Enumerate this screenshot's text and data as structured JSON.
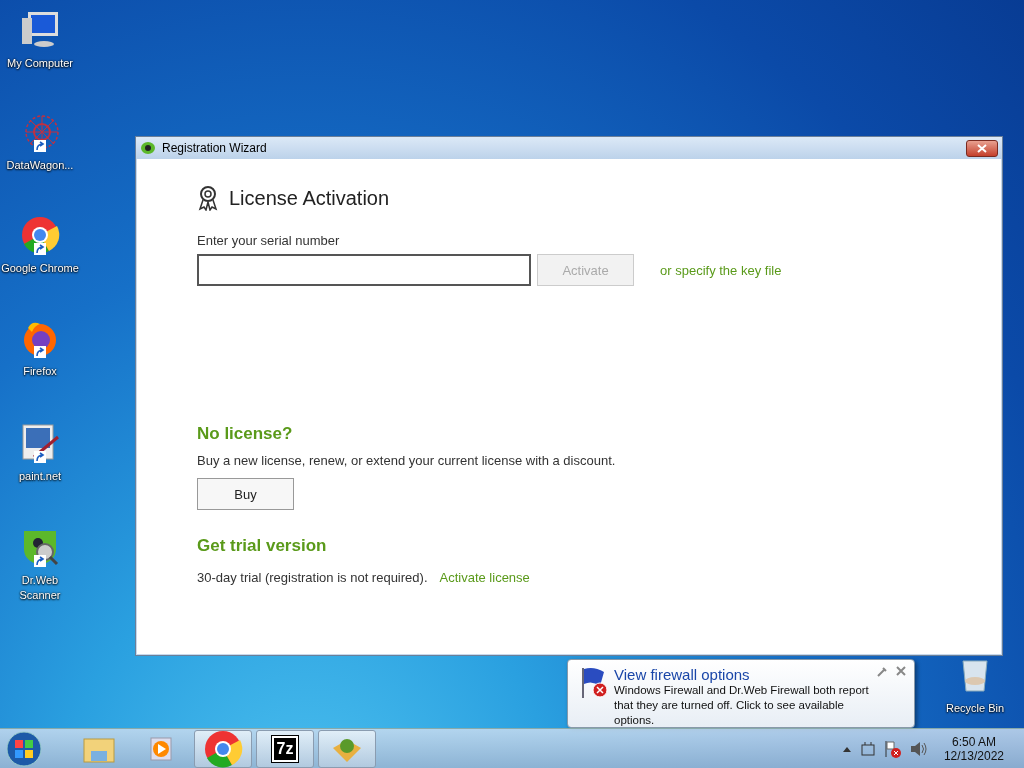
{
  "desktop_icons": [
    {
      "kind": "computer",
      "label": "My Computer",
      "shortcut": false
    },
    {
      "kind": "datawagon",
      "label": "DataWagon...",
      "shortcut": true
    },
    {
      "kind": "chrome",
      "label": "Google Chrome",
      "shortcut": true
    },
    {
      "kind": "firefox",
      "label": "Firefox",
      "shortcut": true
    },
    {
      "kind": "paint",
      "label": "paint.net",
      "shortcut": true
    },
    {
      "kind": "drweb",
      "label": "Dr.Web Scanner",
      "shortcut": true
    },
    {
      "kind": "recycle",
      "label": "Recycle Bin",
      "shortcut": false
    }
  ],
  "window": {
    "title": "Registration Wizard",
    "heading": "License Activation",
    "serial_label": "Enter your serial number",
    "activate_button": {
      "label": "Activate",
      "disabled": true
    },
    "key_file_link": "or specify the key file",
    "no_license": {
      "title": "No license?",
      "text": "Buy a new license, renew, or extend your current license with a discount.",
      "button": "Buy"
    },
    "trial": {
      "title": "Get trial version",
      "text": "30-day trial (registration is not required).",
      "link": "Activate license"
    }
  },
  "balloon": {
    "title": "View firewall options",
    "text": "Windows Firewall and Dr.Web Firewall both report that they are turned off. Click to see available options."
  },
  "taskbar": {
    "items": [
      {
        "kind": "explorer",
        "running": false
      },
      {
        "kind": "media",
        "running": false
      },
      {
        "kind": "chrome",
        "running": true
      },
      {
        "kind": "sevenzip",
        "label": "7z",
        "running": true
      },
      {
        "kind": "drweb",
        "running": true
      }
    ],
    "clock": {
      "time": "6:50 AM",
      "date": "12/13/2022"
    }
  }
}
